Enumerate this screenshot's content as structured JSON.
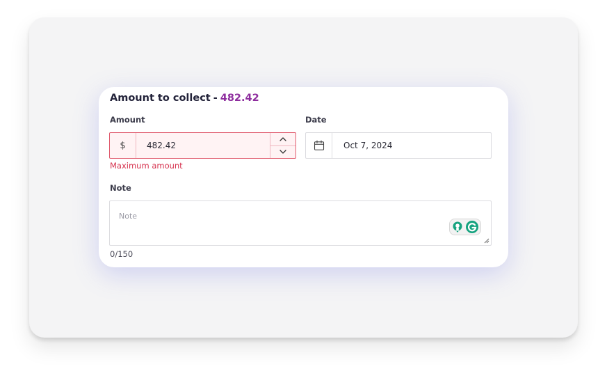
{
  "form": {
    "title_prefix": "Amount to collect",
    "title_separator": "-",
    "title_amount": "482.42",
    "amount_label": "Amount",
    "currency_symbol": "$",
    "amount_value": "482.42",
    "amount_error": "Maximum amount",
    "date_label": "Date",
    "date_value": "Oct 7, 2024",
    "note_label": "Note",
    "note_placeholder": "Note",
    "note_counter": "0/150"
  },
  "colors": {
    "title_amount": "#8e2d9e",
    "error": "#d6334f",
    "error_border": "#e05a6d",
    "error_background": "#fff3f4",
    "grammarly_green": "#15a37f"
  },
  "icons": {
    "date": "calendar-icon",
    "stepper_up": "chevron-up-icon",
    "stepper_down": "chevron-down-icon",
    "extension": "grammarly-icon",
    "resize": "resize-handle-icon"
  }
}
